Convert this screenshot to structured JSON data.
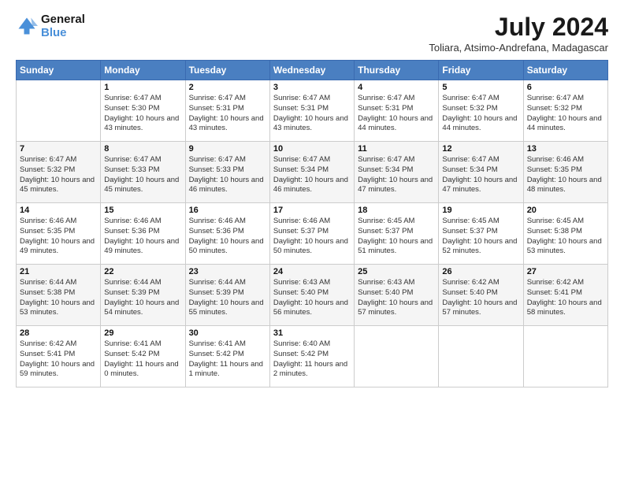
{
  "logo": {
    "line1": "General",
    "line2": "Blue"
  },
  "title": "July 2024",
  "location": "Toliara, Atsimo-Andrefana, Madagascar",
  "days": [
    "Sunday",
    "Monday",
    "Tuesday",
    "Wednesday",
    "Thursday",
    "Friday",
    "Saturday"
  ],
  "weeks": [
    [
      {
        "date": "",
        "sunrise": "",
        "sunset": "",
        "daylight": ""
      },
      {
        "date": "1",
        "sunrise": "Sunrise: 6:47 AM",
        "sunset": "Sunset: 5:30 PM",
        "daylight": "Daylight: 10 hours and 43 minutes."
      },
      {
        "date": "2",
        "sunrise": "Sunrise: 6:47 AM",
        "sunset": "Sunset: 5:31 PM",
        "daylight": "Daylight: 10 hours and 43 minutes."
      },
      {
        "date": "3",
        "sunrise": "Sunrise: 6:47 AM",
        "sunset": "Sunset: 5:31 PM",
        "daylight": "Daylight: 10 hours and 43 minutes."
      },
      {
        "date": "4",
        "sunrise": "Sunrise: 6:47 AM",
        "sunset": "Sunset: 5:31 PM",
        "daylight": "Daylight: 10 hours and 44 minutes."
      },
      {
        "date": "5",
        "sunrise": "Sunrise: 6:47 AM",
        "sunset": "Sunset: 5:32 PM",
        "daylight": "Daylight: 10 hours and 44 minutes."
      },
      {
        "date": "6",
        "sunrise": "Sunrise: 6:47 AM",
        "sunset": "Sunset: 5:32 PM",
        "daylight": "Daylight: 10 hours and 44 minutes."
      }
    ],
    [
      {
        "date": "7",
        "sunrise": "Sunrise: 6:47 AM",
        "sunset": "Sunset: 5:32 PM",
        "daylight": "Daylight: 10 hours and 45 minutes."
      },
      {
        "date": "8",
        "sunrise": "Sunrise: 6:47 AM",
        "sunset": "Sunset: 5:33 PM",
        "daylight": "Daylight: 10 hours and 45 minutes."
      },
      {
        "date": "9",
        "sunrise": "Sunrise: 6:47 AM",
        "sunset": "Sunset: 5:33 PM",
        "daylight": "Daylight: 10 hours and 46 minutes."
      },
      {
        "date": "10",
        "sunrise": "Sunrise: 6:47 AM",
        "sunset": "Sunset: 5:34 PM",
        "daylight": "Daylight: 10 hours and 46 minutes."
      },
      {
        "date": "11",
        "sunrise": "Sunrise: 6:47 AM",
        "sunset": "Sunset: 5:34 PM",
        "daylight": "Daylight: 10 hours and 47 minutes."
      },
      {
        "date": "12",
        "sunrise": "Sunrise: 6:47 AM",
        "sunset": "Sunset: 5:34 PM",
        "daylight": "Daylight: 10 hours and 47 minutes."
      },
      {
        "date": "13",
        "sunrise": "Sunrise: 6:46 AM",
        "sunset": "Sunset: 5:35 PM",
        "daylight": "Daylight: 10 hours and 48 minutes."
      }
    ],
    [
      {
        "date": "14",
        "sunrise": "Sunrise: 6:46 AM",
        "sunset": "Sunset: 5:35 PM",
        "daylight": "Daylight: 10 hours and 49 minutes."
      },
      {
        "date": "15",
        "sunrise": "Sunrise: 6:46 AM",
        "sunset": "Sunset: 5:36 PM",
        "daylight": "Daylight: 10 hours and 49 minutes."
      },
      {
        "date": "16",
        "sunrise": "Sunrise: 6:46 AM",
        "sunset": "Sunset: 5:36 PM",
        "daylight": "Daylight: 10 hours and 50 minutes."
      },
      {
        "date": "17",
        "sunrise": "Sunrise: 6:46 AM",
        "sunset": "Sunset: 5:37 PM",
        "daylight": "Daylight: 10 hours and 50 minutes."
      },
      {
        "date": "18",
        "sunrise": "Sunrise: 6:45 AM",
        "sunset": "Sunset: 5:37 PM",
        "daylight": "Daylight: 10 hours and 51 minutes."
      },
      {
        "date": "19",
        "sunrise": "Sunrise: 6:45 AM",
        "sunset": "Sunset: 5:37 PM",
        "daylight": "Daylight: 10 hours and 52 minutes."
      },
      {
        "date": "20",
        "sunrise": "Sunrise: 6:45 AM",
        "sunset": "Sunset: 5:38 PM",
        "daylight": "Daylight: 10 hours and 53 minutes."
      }
    ],
    [
      {
        "date": "21",
        "sunrise": "Sunrise: 6:44 AM",
        "sunset": "Sunset: 5:38 PM",
        "daylight": "Daylight: 10 hours and 53 minutes."
      },
      {
        "date": "22",
        "sunrise": "Sunrise: 6:44 AM",
        "sunset": "Sunset: 5:39 PM",
        "daylight": "Daylight: 10 hours and 54 minutes."
      },
      {
        "date": "23",
        "sunrise": "Sunrise: 6:44 AM",
        "sunset": "Sunset: 5:39 PM",
        "daylight": "Daylight: 10 hours and 55 minutes."
      },
      {
        "date": "24",
        "sunrise": "Sunrise: 6:43 AM",
        "sunset": "Sunset: 5:40 PM",
        "daylight": "Daylight: 10 hours and 56 minutes."
      },
      {
        "date": "25",
        "sunrise": "Sunrise: 6:43 AM",
        "sunset": "Sunset: 5:40 PM",
        "daylight": "Daylight: 10 hours and 57 minutes."
      },
      {
        "date": "26",
        "sunrise": "Sunrise: 6:42 AM",
        "sunset": "Sunset: 5:40 PM",
        "daylight": "Daylight: 10 hours and 57 minutes."
      },
      {
        "date": "27",
        "sunrise": "Sunrise: 6:42 AM",
        "sunset": "Sunset: 5:41 PM",
        "daylight": "Daylight: 10 hours and 58 minutes."
      }
    ],
    [
      {
        "date": "28",
        "sunrise": "Sunrise: 6:42 AM",
        "sunset": "Sunset: 5:41 PM",
        "daylight": "Daylight: 10 hours and 59 minutes."
      },
      {
        "date": "29",
        "sunrise": "Sunrise: 6:41 AM",
        "sunset": "Sunset: 5:42 PM",
        "daylight": "Daylight: 11 hours and 0 minutes."
      },
      {
        "date": "30",
        "sunrise": "Sunrise: 6:41 AM",
        "sunset": "Sunset: 5:42 PM",
        "daylight": "Daylight: 11 hours and 1 minute."
      },
      {
        "date": "31",
        "sunrise": "Sunrise: 6:40 AM",
        "sunset": "Sunset: 5:42 PM",
        "daylight": "Daylight: 11 hours and 2 minutes."
      },
      {
        "date": "",
        "sunrise": "",
        "sunset": "",
        "daylight": ""
      },
      {
        "date": "",
        "sunrise": "",
        "sunset": "",
        "daylight": ""
      },
      {
        "date": "",
        "sunrise": "",
        "sunset": "",
        "daylight": ""
      }
    ]
  ]
}
